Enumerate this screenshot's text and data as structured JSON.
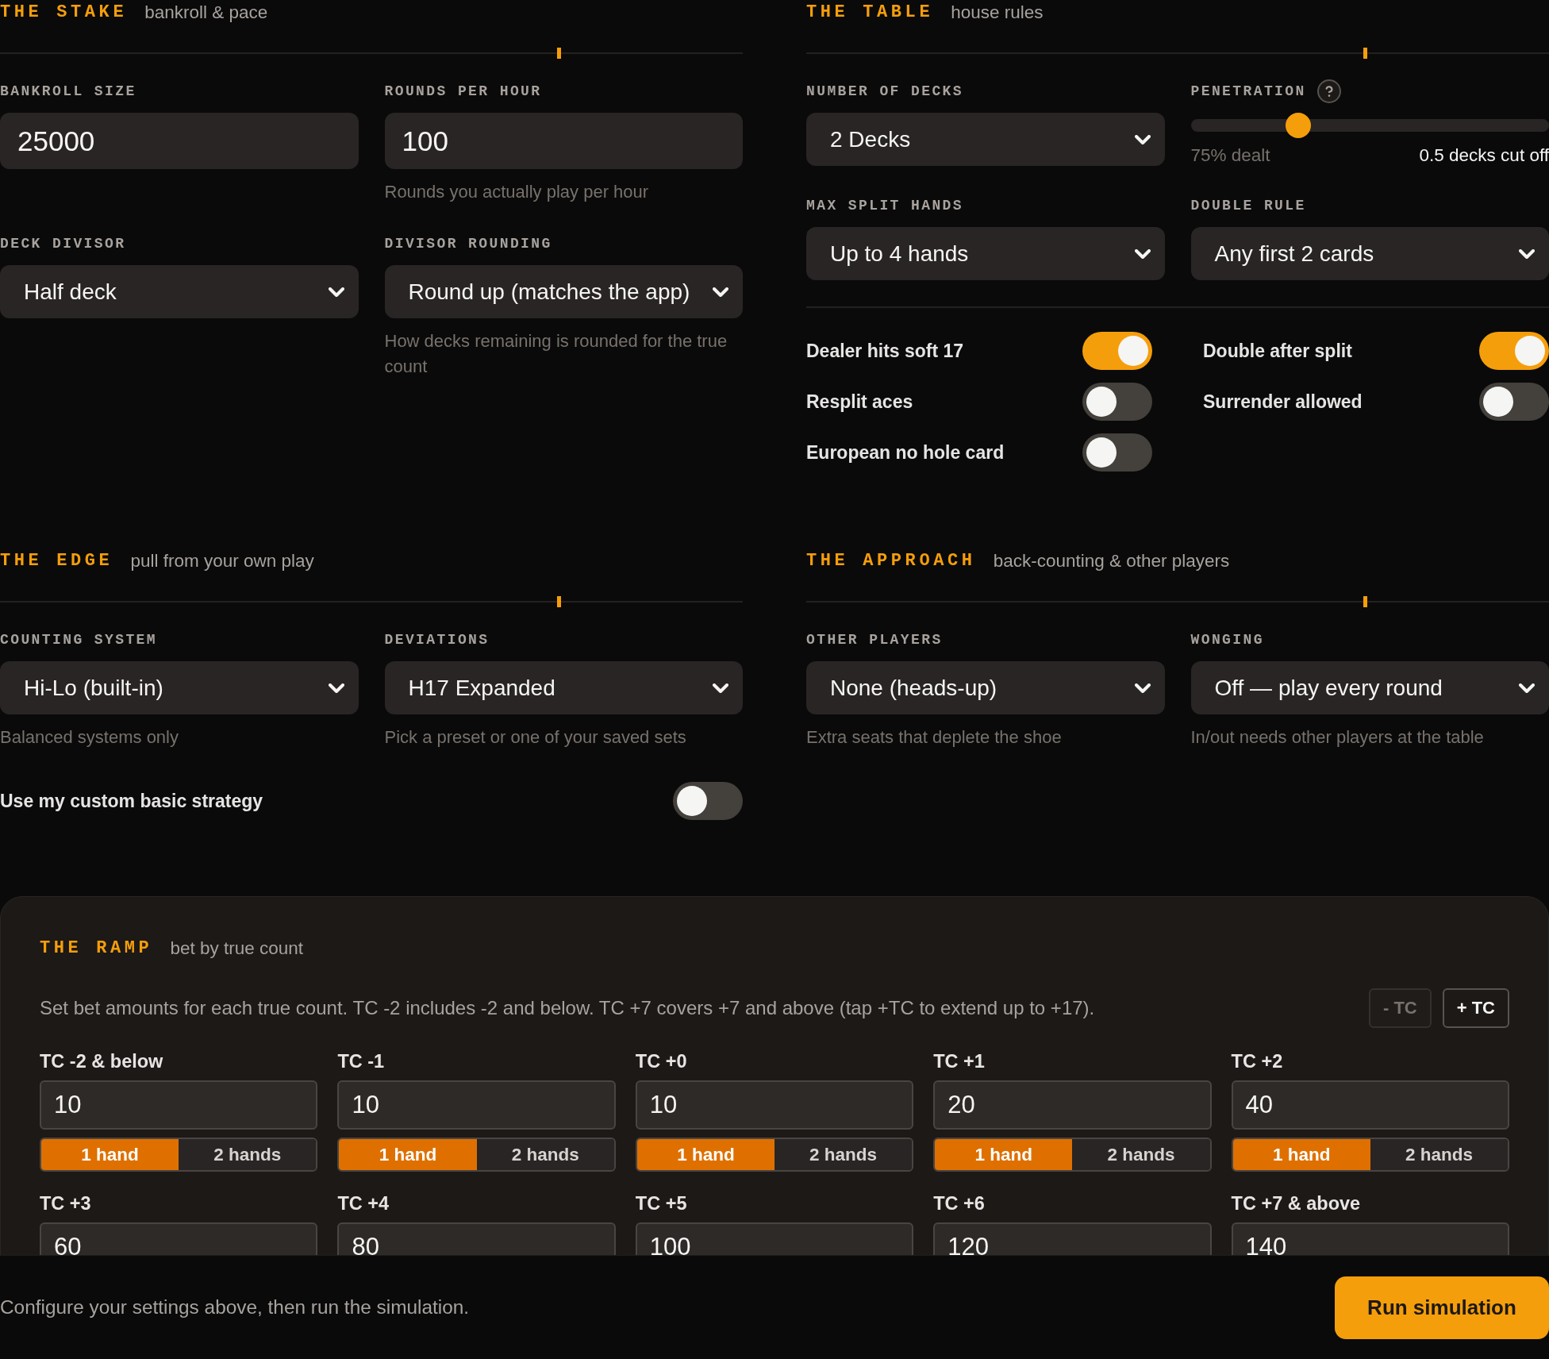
{
  "sections": [
    {
      "title": "THE STAKE",
      "subtitle": "bankroll & pace",
      "fields": [
        {
          "kind": "input",
          "label": "BANKROLL SIZE",
          "value": "25000"
        },
        {
          "kind": "input",
          "label": "ROUNDS PER HOUR",
          "value": "100",
          "hint": "Rounds you actually play per hour"
        },
        {
          "kind": "select",
          "label": "DECK DIVISOR",
          "value": "Half deck"
        },
        {
          "kind": "select",
          "label": "DIVISOR ROUNDING",
          "value": "Round up (matches the app)",
          "hint": "How decks remaining is rounded for the true count"
        }
      ]
    },
    {
      "title": "THE TABLE",
      "subtitle": "house rules",
      "fields": [
        {
          "kind": "select",
          "label": "NUMBER OF DECKS",
          "value": "2 Decks"
        },
        {
          "kind": "slider",
          "label": "PENETRATION",
          "help": true,
          "level": 0.3,
          "reading": "75% dealt",
          "reading_right": "0.5 decks cut off"
        },
        {
          "kind": "select",
          "label": "MAX SPLIT HANDS",
          "value": "Up to 4 hands"
        },
        {
          "kind": "select",
          "label": "DOUBLE RULE",
          "value": "Any first 2 cards"
        }
      ],
      "toggles": [
        {
          "label": "Dealer hits soft 17",
          "on": true
        },
        {
          "label": "Double after split",
          "on": true
        },
        {
          "label": "Resplit aces",
          "on": false
        },
        {
          "label": "Surrender allowed",
          "on": false
        },
        {
          "label": "European no hole card",
          "on": false
        }
      ]
    },
    {
      "title": "THE EDGE",
      "subtitle": "pull from your own play",
      "fields": [
        {
          "kind": "select",
          "label": "COUNTING SYSTEM",
          "value": "Hi-Lo (built-in)",
          "hint": "Balanced systems only"
        },
        {
          "kind": "select",
          "label": "DEVIATIONS",
          "value": "H17 Expanded",
          "hint": "Pick a preset or one of your saved sets"
        }
      ],
      "toggles": [
        {
          "label": "Use my custom basic strategy",
          "on": false
        }
      ]
    },
    {
      "title": "THE APPROACH",
      "subtitle": "back-counting & other players",
      "fields": [
        {
          "kind": "select",
          "label": "OTHER PLAYERS",
          "value": "None (heads-up)",
          "hint": "Extra seats that deplete the shoe"
        },
        {
          "kind": "select",
          "label": "WONGING",
          "value": "Off — play every round",
          "hint": "In/out needs other players at the table"
        }
      ]
    }
  ],
  "ramp": {
    "title": "THE RAMP",
    "subtitle": "bet by true count",
    "description": "Set bet amounts for each true count. TC -2 includes -2 and below. TC +7 covers +7 and above (tap +TC to extend up to +17).",
    "buttons": [
      {
        "label": "- TC",
        "disabled": true
      },
      {
        "label": "+ TC",
        "disabled": false
      }
    ],
    "steps": [
      {
        "label": "TC -2 & below",
        "value": "10",
        "options": [
          {
            "label": "1 hand",
            "selected": true
          },
          {
            "label": "2 hands",
            "selected": false
          }
        ]
      },
      {
        "label": "TC -1",
        "value": "10",
        "options": [
          {
            "label": "1 hand",
            "selected": true
          },
          {
            "label": "2 hands",
            "selected": false
          }
        ]
      },
      {
        "label": "TC +0",
        "value": "10",
        "options": [
          {
            "label": "1 hand",
            "selected": true
          },
          {
            "label": "2 hands",
            "selected": false
          }
        ]
      },
      {
        "label": "TC +1",
        "value": "20",
        "options": [
          {
            "label": "1 hand",
            "selected": true
          },
          {
            "label": "2 hands",
            "selected": false
          }
        ]
      },
      {
        "label": "TC +2",
        "value": "40",
        "options": [
          {
            "label": "1 hand",
            "selected": true
          },
          {
            "label": "2 hands",
            "selected": false
          }
        ]
      },
      {
        "label": "TC +3",
        "value": "60"
      },
      {
        "label": "TC +4",
        "value": "80"
      },
      {
        "label": "TC +5",
        "value": "100"
      },
      {
        "label": "TC +6",
        "value": "120"
      },
      {
        "label": "TC +7 & above",
        "value": "140"
      }
    ]
  },
  "footer": {
    "message": "Configure your settings above, then run the simulation.",
    "button": "Run simulation"
  }
}
